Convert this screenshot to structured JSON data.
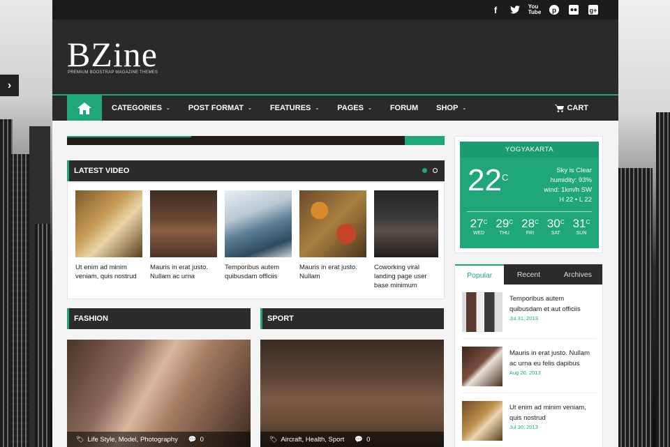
{
  "site": {
    "logo": "BZine",
    "tagline": "PREMIUM BOOSTRAP MAGAZINE THEMES"
  },
  "social_icons": [
    "facebook-icon",
    "twitter-icon",
    "youtube-icon",
    "pinterest-icon",
    "flickr-icon",
    "google-plus-icon"
  ],
  "nav": {
    "items": [
      {
        "label": "CATEGORIES",
        "dropdown": true
      },
      {
        "label": "POST FORMAT",
        "dropdown": true
      },
      {
        "label": "FEATURES",
        "dropdown": true
      },
      {
        "label": "PAGES",
        "dropdown": true
      },
      {
        "label": "FORUM",
        "dropdown": false
      },
      {
        "label": "SHOP",
        "dropdown": true
      }
    ],
    "cart_label": "CART"
  },
  "latest_video": {
    "title": "LATEST VIDEO",
    "items": [
      {
        "caption": "Ut enim ad minim veniam, quis nostrud"
      },
      {
        "caption": "Mauris in erat justo. Nullam ac urna"
      },
      {
        "caption": "Temporibus autem quibusdam officiis"
      },
      {
        "caption": "Mauris in erat justo. Nullam"
      },
      {
        "caption": "Coworking viral landing page user base minimum"
      }
    ]
  },
  "fashion": {
    "title": "FASHION",
    "tags": "Life Style, Model, Photography",
    "comments": "0"
  },
  "sport": {
    "title": "SPORT",
    "tags": "Aircraft, Health, Sport",
    "comments": "0"
  },
  "weather": {
    "city": "YOGYAKARTA",
    "temp": "22",
    "unit": "C",
    "condition": "Sky is Clear",
    "humidity": "humidity: 93%",
    "wind": "wind: 1km/h SW",
    "hilo": "H 22 • L 22",
    "forecast": [
      {
        "temp": "27",
        "day": "WED"
      },
      {
        "temp": "29",
        "day": "THU"
      },
      {
        "temp": "28",
        "day": "FRI"
      },
      {
        "temp": "30",
        "day": "SAT"
      },
      {
        "temp": "31",
        "day": "SUN"
      }
    ]
  },
  "sidebar_tabs": {
    "tabs": [
      "Popular",
      "Recent",
      "Archives"
    ],
    "items": [
      {
        "title": "Temporibus autem quibusdam et aut officiis",
        "date": "Jul 31, 2013"
      },
      {
        "title": "Mauris in erat justo. Nullam ac urna eu felis dapibus",
        "date": "Aug 20, 2013"
      },
      {
        "title": "Ut enim ad minim veniam, quis nostrud",
        "date": "Jul 30, 2013"
      }
    ]
  },
  "colors": {
    "accent": "#1fa67a",
    "dark": "#2a2a2a"
  }
}
